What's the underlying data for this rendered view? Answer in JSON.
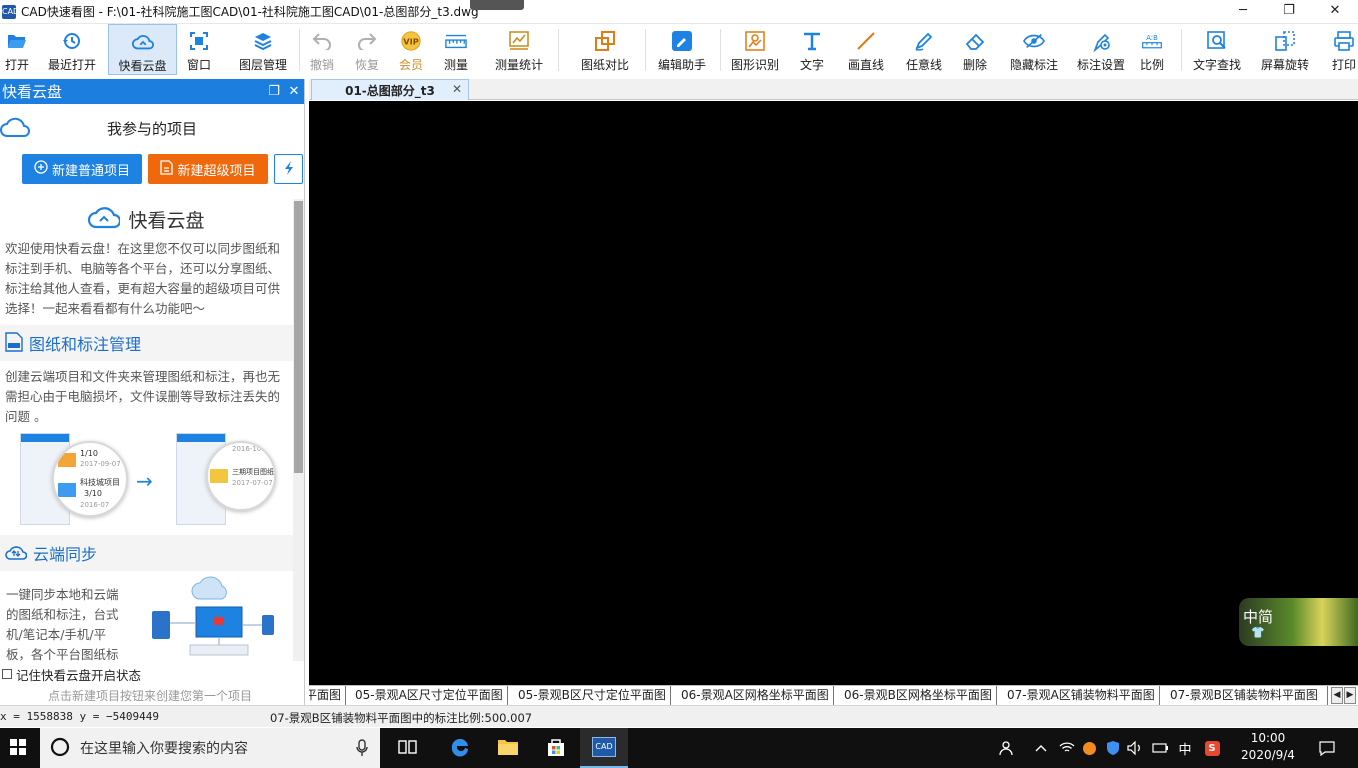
{
  "window": {
    "app_icon_text": "CAD",
    "title": "CAD快速看图 - F:\\01-社科院施工图CAD\\01-社科院施工图CAD\\01-总图部分_t3.dwg",
    "minimize": "─",
    "restore": "❐",
    "close": "✕"
  },
  "toolbar": {
    "items": [
      {
        "label": "打开",
        "icon": "folder-open-icon"
      },
      {
        "label": "最近打开",
        "icon": "history-icon"
      },
      {
        "label": "快看云盘",
        "icon": "cloud-icon",
        "active": true
      },
      {
        "label": "窗口",
        "icon": "window-icon"
      },
      {
        "label": "图层管理",
        "icon": "layers-icon"
      },
      {
        "label": "撤销",
        "icon": "undo-icon",
        "disabled": true
      },
      {
        "label": "恢复",
        "icon": "redo-icon",
        "disabled": true
      },
      {
        "label": "会员",
        "icon": "vip-icon",
        "disabled": true
      },
      {
        "label": "测量",
        "icon": "ruler-icon"
      },
      {
        "label": "测量统计",
        "icon": "measure-stats-icon"
      },
      {
        "label": "图纸对比",
        "icon": "compare-icon"
      },
      {
        "label": "编辑助手",
        "icon": "edit-assistant-icon"
      },
      {
        "label": "图形识别",
        "icon": "shape-recognize-icon"
      },
      {
        "label": "文字",
        "icon": "text-icon"
      },
      {
        "label": "画直线",
        "icon": "line-icon"
      },
      {
        "label": "任意线",
        "icon": "pen-icon"
      },
      {
        "label": "删除",
        "icon": "eraser-icon"
      },
      {
        "label": "隐藏标注",
        "icon": "hide-annotation-icon"
      },
      {
        "label": "标注设置",
        "icon": "annotation-settings-icon"
      },
      {
        "label": "比例",
        "icon": "scale-icon"
      },
      {
        "label": "文字查找",
        "icon": "text-search-icon"
      },
      {
        "label": "屏幕旋转",
        "icon": "rotate-screen-icon"
      },
      {
        "label": "打印",
        "icon": "printer-icon"
      }
    ],
    "more": "»",
    "vip_text": "VIP",
    "scale_text": "A:B"
  },
  "panel": {
    "title": "快看云盘",
    "float_btn": "❐",
    "close_btn": "✕",
    "project_heading": "我参与的项目",
    "new_normal": "新建普通项目",
    "new_super": "新建超级项目",
    "intro": {
      "title": "快看云盘",
      "welcome": "欢迎使用快看云盘！在这里您不仅可以同步图纸和标注到手机、电脑等各个平台，还可以分享图纸、标注给其他人查看，更有超大容量的超级项目可供选择！一起来看看都有什么功能吧～",
      "section1_title": "图纸和标注管理",
      "section1_text": "创建云端项目和文件夹来管理图纸和标注，再也无需担心由于电脑损坏，文件误删等导致标注丢失的问题 。",
      "illus1": {
        "count1": "1/10",
        "date1": "2017-09-07",
        "project2": "科技城项目",
        "count2": "3/10",
        "date2": "2016-07",
        "folder_date": "2016-10",
        "folder_name": "三期项目图纸",
        "folder_date2": "2017-07-07"
      },
      "section2_title": "云端同步",
      "section2_text": "一键同步本地和云端的图纸和标注，台式机/笔记本/手机/平板，各个平台图纸标"
    },
    "remember_label": "记住快看云盘开启状态",
    "hint": "点击新建项目按钮来创建您第一个项目"
  },
  "document": {
    "tab_label": "01-总图部分_t3",
    "tab_close": "✕"
  },
  "ime": {
    "label": "中简",
    "shirt": "👕"
  },
  "layout_tabs": [
    "平面图",
    "05-景观A区尺寸定位平面图",
    "05-景观B区尺寸定位平面图",
    "06-景观A区网格坐标平面图",
    "06-景观B区网格坐标平面图",
    "07-景观A区铺装物料平面图",
    "07-景观B区铺装物料平面图"
  ],
  "layout_nav": {
    "prev": "◀",
    "next": "▶"
  },
  "status": {
    "coords": "x = 1558838  y = −5409449",
    "message": "07-景观B区铺装物料平面图中的标注比例:500.007"
  },
  "taskbar": {
    "search_placeholder": "在这里输入你要搜索的内容",
    "cad_label": "CAD",
    "ime_cn": "中",
    "time": "10:00",
    "date": "2020/9/4"
  },
  "colors": {
    "accent_blue": "#1d82e2",
    "accent_orange": "#f0680c",
    "canvas": "#000000"
  }
}
